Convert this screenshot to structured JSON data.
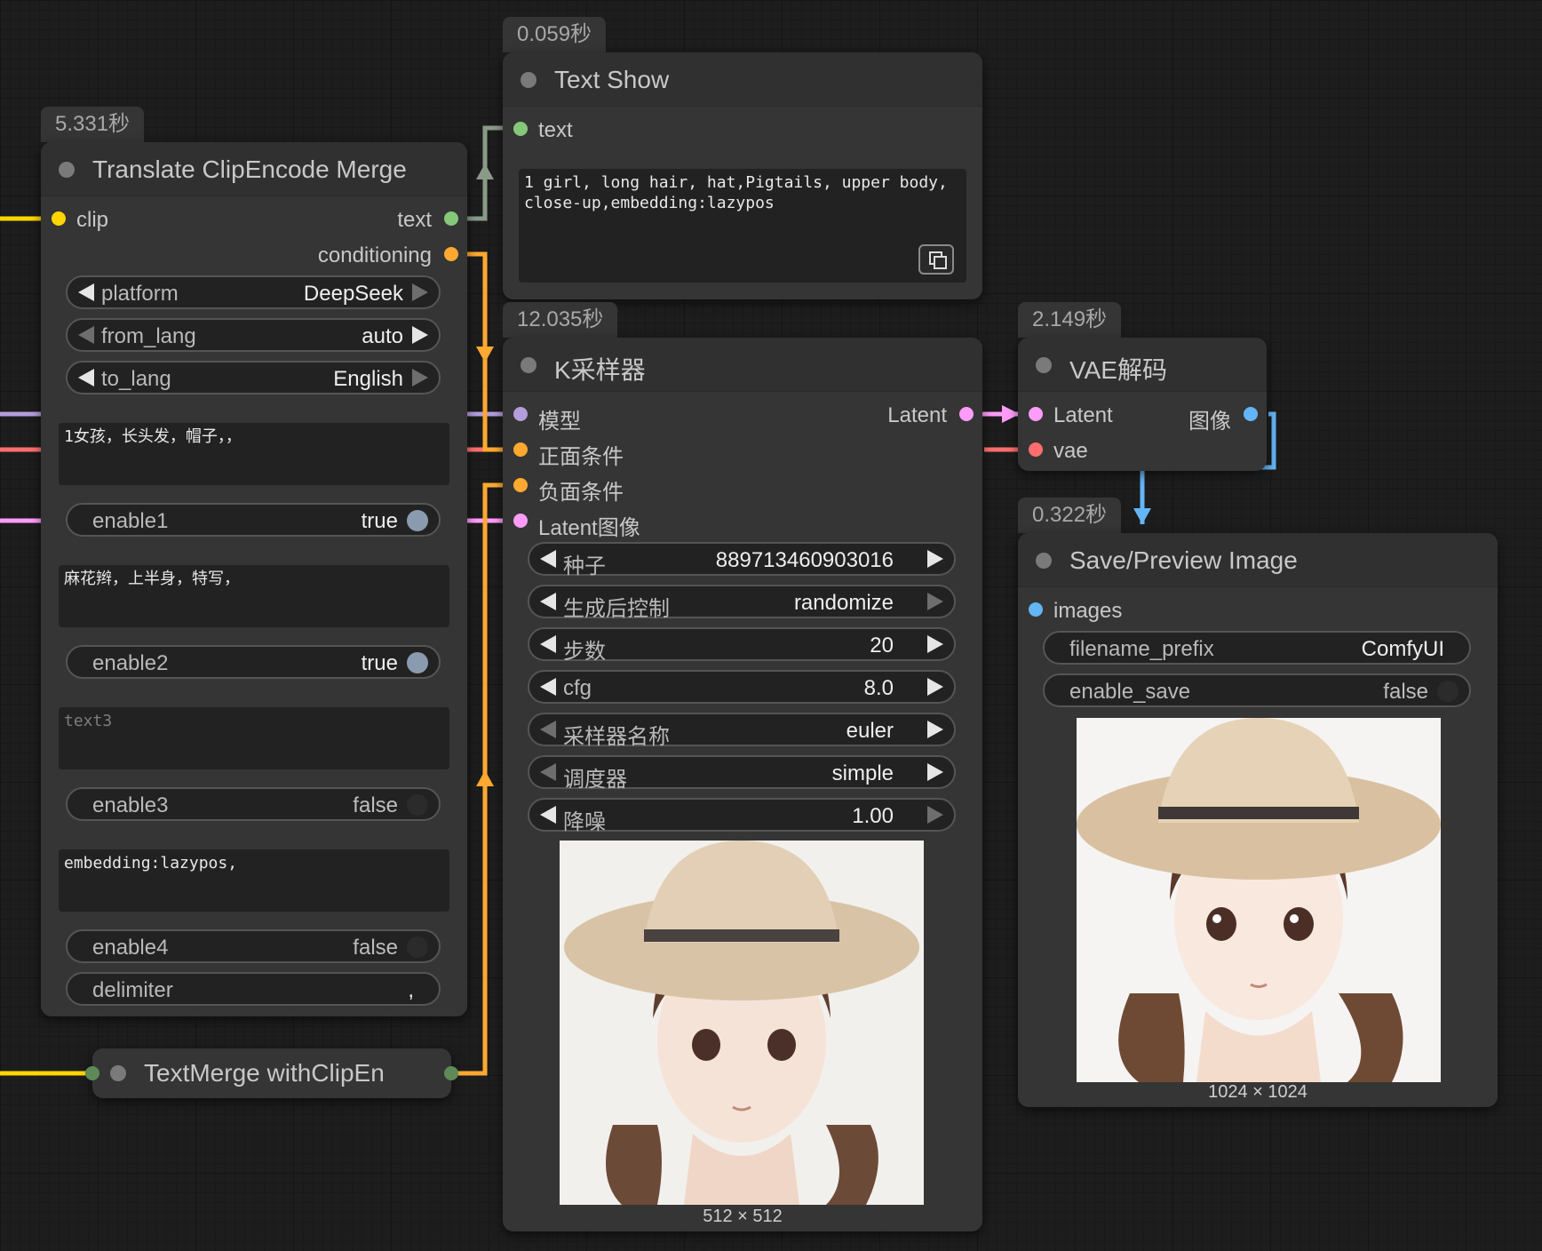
{
  "colors": {
    "clip": "#ffd500",
    "string": "#86c879",
    "conditioning": "#ffa931",
    "model": "#b39ddb",
    "vae": "#ff6e6e",
    "latent": "#ff9cf9",
    "image": "#64b5f6"
  },
  "translate_node": {
    "time": "5.331秒",
    "title": "Translate ClipEncode Merge",
    "inputs": {
      "clip": "clip"
    },
    "outputs": {
      "text": "text",
      "conditioning": "conditioning"
    },
    "platform": {
      "name": "platform",
      "value": "DeepSeek"
    },
    "from_lang": {
      "name": "from_lang",
      "value": "auto"
    },
    "to_lang": {
      "name": "to_lang",
      "value": "English"
    },
    "text1": "1女孩，长头发，帽子，，",
    "enable1": {
      "name": "enable1",
      "value": "true"
    },
    "text2": "麻花辫，上半身，特写，",
    "enable2": {
      "name": "enable2",
      "value": "true"
    },
    "text3_placeholder": "text3",
    "enable3": {
      "name": "enable3",
      "value": "false"
    },
    "text4": "embedding:lazypos,",
    "enable4": {
      "name": "enable4",
      "value": "false"
    },
    "delimiter": {
      "name": "delimiter",
      "value": ","
    }
  },
  "textmerge_node": {
    "title": "TextMerge withClipEn"
  },
  "textshow_node": {
    "time": "0.059秒",
    "title": "Text Show",
    "input": "text",
    "text": "1 girl, long hair, hat,Pigtails, upper body, close-up,embedding:lazypos"
  },
  "ksampler_node": {
    "time": "12.035秒",
    "title": "K采样器",
    "inputs": {
      "model": "模型",
      "positive": "正面条件",
      "negative": "负面条件",
      "latent": "Latent图像"
    },
    "output": "Latent",
    "seed": {
      "name": "种子",
      "value": "889713460903016"
    },
    "control": {
      "name": "生成后控制",
      "value": "randomize"
    },
    "steps": {
      "name": "步数",
      "value": "20"
    },
    "cfg": {
      "name": "cfg",
      "value": "8.0"
    },
    "sampler": {
      "name": "采样器名称",
      "value": "euler"
    },
    "scheduler": {
      "name": "调度器",
      "value": "simple"
    },
    "denoise": {
      "name": "降噪",
      "value": "1.00"
    },
    "preview_size": "512 × 512"
  },
  "vae_node": {
    "time": "2.149秒",
    "title": "VAE解码",
    "inputs": {
      "latent": "Latent",
      "vae": "vae"
    },
    "output": "图像"
  },
  "save_node": {
    "time": "0.322秒",
    "title": "Save/Preview Image",
    "input": "images",
    "filename_prefix": {
      "name": "filename_prefix",
      "value": "ComfyUI"
    },
    "enable_save": {
      "name": "enable_save",
      "value": "false"
    },
    "image_size": "1024 × 1024"
  }
}
